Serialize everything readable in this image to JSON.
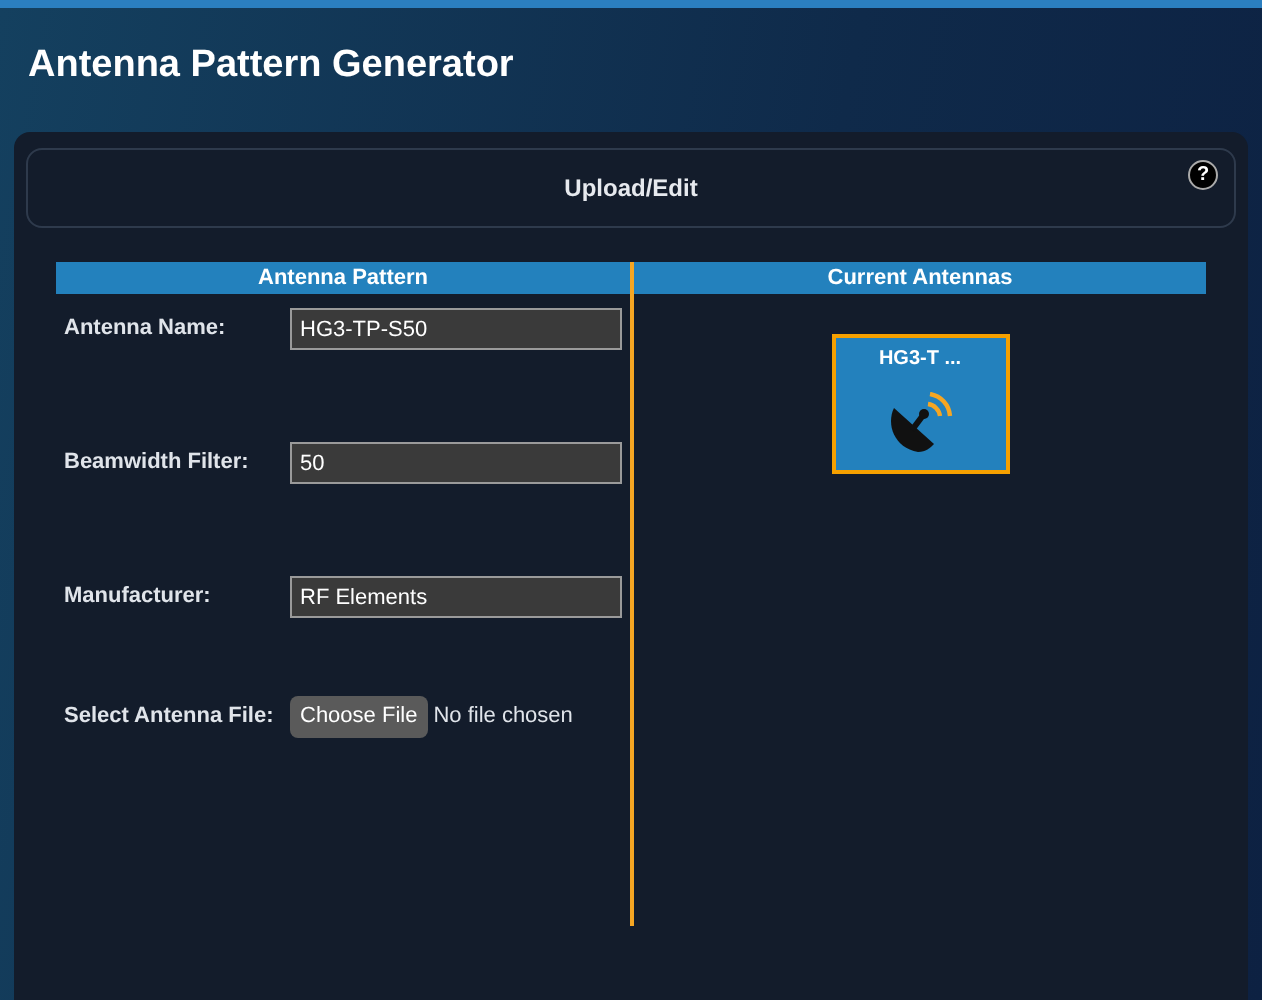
{
  "header": {
    "title": "Antenna Pattern Generator"
  },
  "section": {
    "title": "Upload/Edit",
    "help": "?"
  },
  "form": {
    "heading": "Antenna Pattern",
    "fields": [
      {
        "label": "Antenna Name:",
        "value": "HG3-TP-S50"
      },
      {
        "label": "Beamwidth Filter:",
        "value": "50"
      },
      {
        "label": "Manufacturer:",
        "value": "RF Elements"
      }
    ],
    "file": {
      "label": "Select Antenna File:",
      "button": "Choose File",
      "status": "No file chosen"
    }
  },
  "antennas": {
    "heading": "Current Antennas",
    "items": [
      {
        "name": "HG3-T ...",
        "selected": true
      }
    ]
  }
}
